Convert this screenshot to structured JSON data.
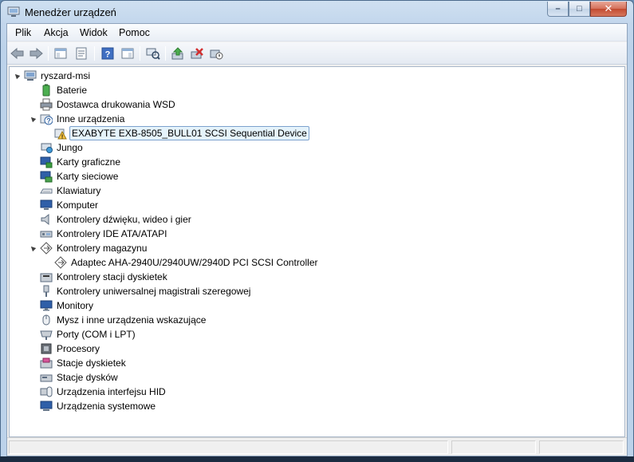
{
  "window": {
    "title": "Menedżer urządzeń",
    "controls": {
      "minimize": "–",
      "maximize": "□",
      "close": "✕"
    }
  },
  "menu": [
    {
      "label": "Plik"
    },
    {
      "label": "Akcja"
    },
    {
      "label": "Widok"
    },
    {
      "label": "Pomoc"
    }
  ],
  "toolbar": [
    {
      "icon": "back-arrow-icon"
    },
    {
      "icon": "forward-arrow-icon"
    },
    {
      "icon": "console-tree-icon"
    },
    {
      "icon": "properties-icon"
    },
    {
      "icon": "help-icon"
    },
    {
      "icon": "show-hide-action-pane-icon"
    },
    {
      "icon": "scan-hardware-icon"
    },
    {
      "icon": "update-driver-icon"
    },
    {
      "icon": "uninstall-icon"
    },
    {
      "icon": "disable-device-icon"
    }
  ],
  "tree": {
    "root": {
      "label": "ryszard-msi",
      "icon": "computer-icon"
    },
    "items": [
      {
        "label": "Baterie",
        "icon": "battery-icon",
        "expanded": false
      },
      {
        "label": "Dostawca drukowania WSD",
        "icon": "printer-icon",
        "expanded": false
      },
      {
        "label": "Inne urządzenia",
        "icon": "unknown-device-icon",
        "expanded": true,
        "children": [
          {
            "label": "EXABYTE EXB-8505_BULL01 SCSI Sequential Device",
            "icon": "unknown-device-warning-icon",
            "selected": true
          }
        ]
      },
      {
        "label": "Jungo",
        "icon": "jungo-icon",
        "expanded": false
      },
      {
        "label": "Karty graficzne",
        "icon": "display-adapter-icon",
        "expanded": false
      },
      {
        "label": "Karty sieciowe",
        "icon": "network-adapter-icon",
        "expanded": false
      },
      {
        "label": "Klawiatury",
        "icon": "keyboard-icon",
        "expanded": false
      },
      {
        "label": "Komputer",
        "icon": "computer-monitor-icon",
        "expanded": false
      },
      {
        "label": "Kontrolery dźwięku, wideo i gier",
        "icon": "speaker-icon",
        "expanded": false
      },
      {
        "label": "Kontrolery IDE ATA/ATAPI",
        "icon": "ide-controller-icon",
        "expanded": false
      },
      {
        "label": "Kontrolery magazynu",
        "icon": "storage-controller-icon",
        "expanded": true,
        "children": [
          {
            "label": "Adaptec AHA-2940U/2940UW/2940D PCI SCSI Controller",
            "icon": "scsi-controller-icon",
            "selected": false
          }
        ]
      },
      {
        "label": "Kontrolery stacji dyskietek",
        "icon": "floppy-controller-icon",
        "expanded": false
      },
      {
        "label": "Kontrolery uniwersalnej magistrali szeregowej",
        "icon": "usb-icon",
        "expanded": false
      },
      {
        "label": "Monitory",
        "icon": "monitor-icon",
        "expanded": false
      },
      {
        "label": "Mysz i inne urządzenia wskazujące",
        "icon": "mouse-icon",
        "expanded": false
      },
      {
        "label": "Porty (COM i LPT)",
        "icon": "port-icon",
        "expanded": false
      },
      {
        "label": "Procesory",
        "icon": "processor-icon",
        "expanded": false
      },
      {
        "label": "Stacje dyskietek",
        "icon": "floppy-drive-icon",
        "expanded": false
      },
      {
        "label": "Stacje dysków",
        "icon": "disk-drive-icon",
        "expanded": false
      },
      {
        "label": "Urządzenia interfejsu HID",
        "icon": "hid-icon",
        "expanded": false
      },
      {
        "label": "Urządzenia systemowe",
        "icon": "system-devices-icon",
        "expanded": false
      }
    ]
  }
}
